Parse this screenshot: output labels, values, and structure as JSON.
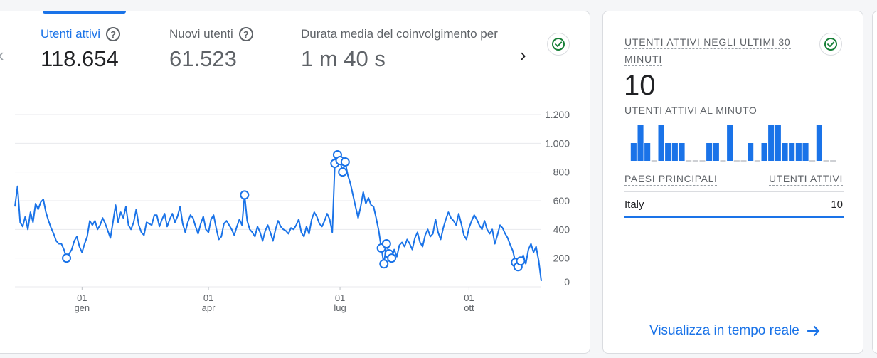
{
  "metrics": [
    {
      "label": "Utenti attivi",
      "value": "118.654"
    },
    {
      "label": "Nuovi utenti",
      "value": "61.523"
    },
    {
      "label": "Durata media del coinvolgimento per",
      "value": "1 m 40 s"
    }
  ],
  "icons": {
    "prev": "chevron-left-icon",
    "next": "chevron-right-icon",
    "status": "check-circle-icon",
    "help": "help-circle-icon",
    "link": "arrow-right-icon"
  },
  "colors": {
    "accent": "#1a73e8",
    "check": "#188038",
    "grid": "#e8eaed"
  },
  "chart_data": {
    "type": "line",
    "series": [
      {
        "x_label": "date",
        "values": [
          [
            0,
            560
          ],
          [
            1,
            700
          ],
          [
            2,
            450
          ],
          [
            3,
            420
          ],
          [
            4,
            490
          ],
          [
            5,
            400
          ],
          [
            6,
            520
          ],
          [
            7,
            450
          ],
          [
            8,
            580
          ],
          [
            9,
            540
          ],
          [
            10,
            590
          ],
          [
            11,
            610
          ],
          [
            12,
            520
          ],
          [
            13,
            460
          ],
          [
            14,
            410
          ],
          [
            15,
            370
          ],
          [
            16,
            320
          ],
          [
            17,
            300
          ],
          [
            18,
            300
          ],
          [
            19,
            260
          ],
          [
            20,
            200
          ],
          [
            21,
            230
          ],
          [
            22,
            260
          ],
          [
            23,
            320
          ],
          [
            24,
            350
          ],
          [
            25,
            280
          ],
          [
            26,
            240
          ],
          [
            27,
            300
          ],
          [
            28,
            350
          ],
          [
            29,
            460
          ],
          [
            30,
            430
          ],
          [
            31,
            460
          ],
          [
            32,
            400
          ],
          [
            33,
            430
          ],
          [
            34,
            480
          ],
          [
            35,
            440
          ],
          [
            36,
            390
          ],
          [
            37,
            340
          ],
          [
            38,
            450
          ],
          [
            39,
            570
          ],
          [
            40,
            450
          ],
          [
            41,
            520
          ],
          [
            42,
            480
          ],
          [
            43,
            560
          ],
          [
            44,
            430
          ],
          [
            45,
            400
          ],
          [
            46,
            450
          ],
          [
            47,
            540
          ],
          [
            48,
            430
          ],
          [
            49,
            380
          ],
          [
            50,
            360
          ],
          [
            51,
            450
          ],
          [
            52,
            440
          ],
          [
            53,
            430
          ],
          [
            54,
            500
          ],
          [
            55,
            500
          ],
          [
            56,
            420
          ],
          [
            57,
            470
          ],
          [
            58,
            510
          ],
          [
            59,
            420
          ],
          [
            60,
            470
          ],
          [
            61,
            510
          ],
          [
            62,
            450
          ],
          [
            63,
            490
          ],
          [
            64,
            560
          ],
          [
            65,
            440
          ],
          [
            66,
            380
          ],
          [
            67,
            450
          ],
          [
            68,
            500
          ],
          [
            69,
            480
          ],
          [
            70,
            420
          ],
          [
            71,
            370
          ],
          [
            72,
            440
          ],
          [
            73,
            490
          ],
          [
            74,
            400
          ],
          [
            75,
            380
          ],
          [
            76,
            470
          ],
          [
            77,
            500
          ],
          [
            78,
            410
          ],
          [
            79,
            330
          ],
          [
            80,
            350
          ],
          [
            81,
            440
          ],
          [
            82,
            460
          ],
          [
            83,
            430
          ],
          [
            84,
            400
          ],
          [
            85,
            360
          ],
          [
            86,
            420
          ],
          [
            87,
            470
          ],
          [
            88,
            430
          ],
          [
            89,
            640
          ],
          [
            90,
            460
          ],
          [
            91,
            400
          ],
          [
            92,
            380
          ],
          [
            93,
            350
          ],
          [
            94,
            420
          ],
          [
            95,
            380
          ],
          [
            96,
            320
          ],
          [
            97,
            390
          ],
          [
            98,
            430
          ],
          [
            99,
            380
          ],
          [
            100,
            320
          ],
          [
            101,
            400
          ],
          [
            102,
            460
          ],
          [
            103,
            420
          ],
          [
            104,
            400
          ],
          [
            105,
            390
          ],
          [
            106,
            370
          ],
          [
            107,
            410
          ],
          [
            108,
            400
          ],
          [
            109,
            430
          ],
          [
            110,
            470
          ],
          [
            111,
            380
          ],
          [
            112,
            350
          ],
          [
            113,
            420
          ],
          [
            114,
            370
          ],
          [
            115,
            470
          ],
          [
            116,
            520
          ],
          [
            117,
            490
          ],
          [
            118,
            440
          ],
          [
            119,
            420
          ],
          [
            120,
            460
          ],
          [
            121,
            510
          ],
          [
            122,
            470
          ],
          [
            123,
            380
          ],
          [
            124,
            860
          ],
          [
            125,
            920
          ],
          [
            126,
            880
          ],
          [
            127,
            800
          ],
          [
            128,
            870
          ],
          [
            129,
            780
          ],
          [
            130,
            720
          ],
          [
            131,
            640
          ],
          [
            132,
            560
          ],
          [
            133,
            480
          ],
          [
            134,
            560
          ],
          [
            135,
            660
          ],
          [
            136,
            580
          ],
          [
            137,
            620
          ],
          [
            138,
            570
          ],
          [
            139,
            560
          ],
          [
            140,
            480
          ],
          [
            141,
            390
          ],
          [
            142,
            270
          ],
          [
            143,
            160
          ],
          [
            144,
            300
          ],
          [
            145,
            230
          ],
          [
            146,
            200
          ],
          [
            147,
            260
          ],
          [
            148,
            210
          ],
          [
            149,
            290
          ],
          [
            150,
            310
          ],
          [
            151,
            280
          ],
          [
            152,
            330
          ],
          [
            153,
            300
          ],
          [
            154,
            260
          ],
          [
            155,
            340
          ],
          [
            156,
            380
          ],
          [
            157,
            310
          ],
          [
            158,
            280
          ],
          [
            159,
            360
          ],
          [
            160,
            400
          ],
          [
            161,
            350
          ],
          [
            162,
            370
          ],
          [
            163,
            470
          ],
          [
            164,
            380
          ],
          [
            165,
            330
          ],
          [
            166,
            410
          ],
          [
            167,
            470
          ],
          [
            168,
            520
          ],
          [
            169,
            480
          ],
          [
            170,
            460
          ],
          [
            171,
            430
          ],
          [
            172,
            510
          ],
          [
            173,
            440
          ],
          [
            174,
            360
          ],
          [
            175,
            330
          ],
          [
            176,
            410
          ],
          [
            177,
            460
          ],
          [
            178,
            500
          ],
          [
            179,
            470
          ],
          [
            180,
            430
          ],
          [
            181,
            400
          ],
          [
            182,
            460
          ],
          [
            183,
            400
          ],
          [
            184,
            370
          ],
          [
            185,
            400
          ],
          [
            186,
            300
          ],
          [
            187,
            360
          ],
          [
            188,
            430
          ],
          [
            189,
            410
          ],
          [
            190,
            370
          ],
          [
            191,
            340
          ],
          [
            192,
            290
          ],
          [
            193,
            250
          ],
          [
            194,
            170
          ],
          [
            195,
            140
          ],
          [
            196,
            180
          ],
          [
            197,
            220
          ],
          [
            198,
            160
          ],
          [
            199,
            260
          ],
          [
            200,
            300
          ],
          [
            201,
            240
          ],
          [
            202,
            280
          ],
          [
            203,
            180
          ],
          [
            204,
            40
          ]
        ],
        "markers": [
          20,
          89,
          124,
          125,
          126,
          127,
          128,
          142,
          143,
          144,
          145,
          146,
          194,
          195,
          196
        ]
      }
    ],
    "ylim": [
      0,
      1200
    ],
    "yticks": [
      "1.200",
      "1.000",
      "800",
      "600",
      "400",
      "200",
      "0"
    ],
    "ytick_values": [
      1200,
      1000,
      800,
      600,
      400,
      200,
      0
    ],
    "xticks": [
      {
        "day": "01",
        "month": "gen",
        "at": 26
      },
      {
        "day": "01",
        "month": "apr",
        "at": 75
      },
      {
        "day": "01",
        "month": "lug",
        "at": 126
      },
      {
        "day": "01",
        "month": "ott",
        "at": 176
      }
    ],
    "grid": true
  },
  "realtime": {
    "title": "UTENTI ATTIVI NEGLI ULTIMI 30 MINUTI",
    "value": "10",
    "per_minute_label": "UTENTI ATTIVI AL MINUTO",
    "per_minute_values": [
      1,
      2,
      1,
      0,
      2,
      1,
      1,
      1,
      0,
      0,
      0,
      1,
      1,
      0,
      2,
      0,
      0,
      1,
      0,
      1,
      2,
      2,
      1,
      1,
      1,
      1,
      0,
      2,
      0,
      0
    ],
    "table": {
      "col1": "PAESI PRINCIPALI",
      "col2": "UTENTI ATTIVI",
      "rows": [
        {
          "country": "Italy",
          "users": "10",
          "share": 1.0
        }
      ]
    },
    "link": "Visualizza in tempo reale"
  }
}
